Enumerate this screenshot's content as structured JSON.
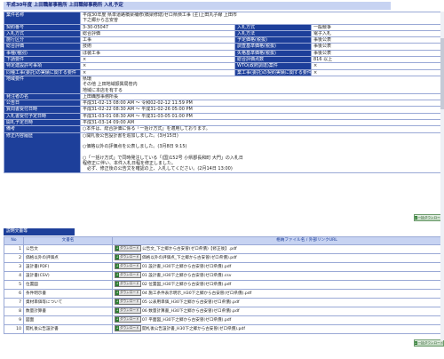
{
  "header": {
    "title": "平成30年度 上田職部事務所 上田職部事務所 入札予定"
  },
  "info_rows": [
    {
      "cells": [
        {
          "label": "業件名称",
          "value": "平成30年度 県単道路橋梁補修(橋梁修繕)ゼロ県債工事 (主)上田丸子線 上田市\n下之郷から古安曽",
          "colspan": 3,
          "wrap": true
        }
      ]
    },
    {
      "cells": [
        {
          "label": "契約番号",
          "value": "3-30-05047"
        },
        {
          "label": "入札方式",
          "value": "一般競争"
        }
      ]
    },
    {
      "cells": [
        {
          "label": "入札方式",
          "value": "総合評価"
        },
        {
          "label": "入札方法",
          "value": "電子入札"
        }
      ]
    },
    {
      "cells": [
        {
          "label": "施行区分",
          "value": "工事"
        },
        {
          "label": "予定価格(税抜)",
          "value": "事後公表"
        }
      ]
    },
    {
      "cells": [
        {
          "label": "総合評価",
          "value": "技術"
        },
        {
          "label": "調査基準価格(税抜)",
          "value": "事後公表"
        }
      ]
    },
    {
      "cells": [
        {
          "label": "事種(種別)",
          "value": "ほ装工事"
        },
        {
          "label": "失格基準価格(税抜)",
          "value": "事後公表"
        }
      ]
    },
    {
      "cells": [
        {
          "label": "下請要件",
          "value": "×"
        },
        {
          "label": "総合評価点数",
          "value": "816 以上"
        }
      ]
    },
    {
      "cells": [
        {
          "label": "特定建設許可事項",
          "value": "×"
        },
        {
          "label": "WTO(政府調達)案件",
          "value": "×"
        }
      ]
    },
    {
      "cells": [
        {
          "label": "同種工事(委託)の実績に関する要件",
          "value": "×"
        },
        {
          "label": "業工事(委託)の契約実績に関する要件",
          "value": "×"
        }
      ]
    },
    {
      "cells": [
        {
          "label": "地域要件",
          "value": "県環\nその他 上田地域振興局管内\n地域に本店を有する",
          "colspan": 3,
          "wrap": true
        }
      ]
    },
    {
      "cells": [
        {
          "label": "発注者の名",
          "value": "上田職部事務所長",
          "colspan": 3
        }
      ]
    },
    {
      "cells": [
        {
          "label": "公告日",
          "value": "平成31-02-13 08:00 AM ～ 令和02-02-12 11:59 PM",
          "colspan": 3
        }
      ]
    },
    {
      "cells": [
        {
          "label": "質問書受付日時",
          "value": "平成31-02-22 08:30 AM ～ 平成31-02-26 05:00 PM",
          "colspan": 3
        }
      ]
    },
    {
      "cells": [
        {
          "label": "入札書受付予定日時",
          "value": "平成31-03-01 08:30 AM ～ 平成31-03-05 01:00 PM",
          "colspan": 3
        }
      ]
    },
    {
      "cells": [
        {
          "label": "開札予定日時",
          "value": "平成31-03-14 09:00 AM",
          "colspan": 3
        }
      ]
    },
    {
      "cells": [
        {
          "label": "備考",
          "value": "○本件は、総合評価に係る「一括け方式」を適用しております。",
          "colspan": 3
        }
      ]
    },
    {
      "cells": [
        {
          "label": "修正内容履歴",
          "value": "○開札後公告設計書を追加しました。(3月15日)\n\n○価格以外の評価点を公表しました。(3月8日 9:15)\n\n○「一括け方式」で同時発注している「(国)152号 小県郡長和町 大門」の入札日\n程修正に伴い、本件入札日程を修正しました。\n　必ず、修正後の公告文を確認の上、入札してください。(2月14日 13:00)",
          "colspan": 3,
          "wrap": true
        }
      ]
    }
  ],
  "download_all_label": "一括ダウンロード",
  "docs_section": {
    "title": "説明文書等",
    "columns": [
      "No",
      "文書名",
      "格納ファイル名 / 外部リンクURL"
    ],
    "download_label": "ダウンロード",
    "rows": [
      {
        "no": "1",
        "name": "公告文",
        "file": "公告文_下之郷から古安曽(ゼロ県債)【修正後】.pdf"
      },
      {
        "no": "2",
        "name": "価格以外の評価点",
        "file": "価格以外の評価点_下之郷から古安曽(ゼロ県債).pdf"
      },
      {
        "no": "3",
        "name": "設計書(PDF)",
        "file": "01 設計書_H30下之郷から古安曽(ゼロ県債).pdf"
      },
      {
        "no": "4",
        "name": "設計書(CSV)",
        "file": "01 設計書_H30下之郷から古安曽(ゼロ県債).csv"
      },
      {
        "no": "5",
        "name": "位置図",
        "file": "02 位置図_H30下之郷から古安曽(ゼロ県債).pdf"
      },
      {
        "no": "6",
        "name": "条件明示書",
        "file": "04 施工条件表示明示_H30下之郷から古安曽(ゼロ県債).pdf"
      },
      {
        "no": "7",
        "name": "資材単価等について",
        "file": "05 公表用単価_H30下之郷から古安曽(ゼロ県債).pdf"
      },
      {
        "no": "8",
        "name": "数量計算書",
        "file": "06 数量計算書_H30下之郷から古安曽(ゼロ県債).pdf"
      },
      {
        "no": "9",
        "name": "図面",
        "file": "07 平面図_H30下之郷から古安曽(ゼロ県債).pdf"
      },
      {
        "no": "10",
        "name": "開札後公告設計書",
        "file": "開札後公告設計書_H30下之郷から古安曽(ゼロ県債).pdf"
      }
    ]
  }
}
